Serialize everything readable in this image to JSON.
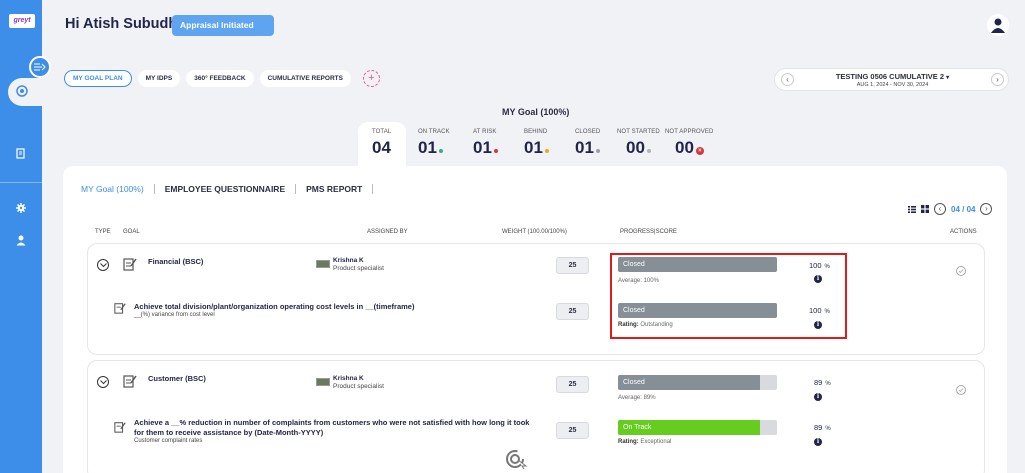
{
  "app": {
    "logo_text": "greyt"
  },
  "header": {
    "greeting": "Hi Atish Subudhi",
    "badge": "Appraisal Initiated"
  },
  "tabs": [
    "MY GOAL PLAN",
    "MY IDPS",
    "360° FEEDBACK",
    "CUMULATIVE REPORTS"
  ],
  "cycle": {
    "title": "TESTING 0506 CUMULATIVE 2",
    "dates": "AUG 1, 2024 - NOV 30, 2024"
  },
  "summary": {
    "title": "MY Goal (100%)",
    "stats": [
      {
        "label": "TOTAL",
        "value": "04"
      },
      {
        "label": "ON TRACK",
        "value": "01",
        "color": "#2bb673"
      },
      {
        "label": "AT RISK",
        "value": "01",
        "color": "#d9363e"
      },
      {
        "label": "BEHIND",
        "value": "01",
        "color": "#f2a91e"
      },
      {
        "label": "CLOSED",
        "value": "01",
        "color": "#9aa0a6"
      },
      {
        "label": "NOT STARTED",
        "value": "00",
        "color": "#b0b3b8"
      },
      {
        "label": "NOT APPROVED",
        "value": "00",
        "color": "#d9363e"
      }
    ]
  },
  "subtabs": [
    "MY Goal (100%)",
    "EMPLOYEE QUESTIONNAIRE",
    "PMS REPORT"
  ],
  "pagination": {
    "label": "04 / 04"
  },
  "columns": {
    "type": "TYPE",
    "goal": "GOAL",
    "assigned_by": "ASSIGNED BY",
    "weight": "WEIGHT (100.00/100%)",
    "progress": "PROGRESS|SCORE",
    "actions": "ACTIONS"
  },
  "goals": [
    {
      "name": "Financial (BSC)",
      "assigned_name": "Krishna K",
      "assigned_role": "Product specialist",
      "weight": "25",
      "status": "Closed",
      "progress": 1.0,
      "sub_label": "Average: 100%",
      "score": "100",
      "unit": "%",
      "sub": {
        "text": "Achieve total division/plant/organization operating cost levels in __(timeframe)",
        "subtext": "__(%) variance from cost level",
        "weight": "25",
        "status": "Closed",
        "progress": 1.0,
        "rating_label": "Rating:",
        "rating": "Outstanding",
        "score": "100",
        "unit": "%"
      }
    },
    {
      "name": "Customer (BSC)",
      "assigned_name": "Krishna K",
      "assigned_role": "Product specialist",
      "weight": "25",
      "status": "Closed",
      "progress": 0.89,
      "sub_label": "Average: 89%",
      "score": "89",
      "unit": "%",
      "sub": {
        "text_line1": "Achieve a __% reduction in number of complaints from customers who were not satisfied with how long it took",
        "text_line2": "for them to receive assistance by (Date-Month-YYYY)",
        "subtext": "Customer complaint rates",
        "weight": "25",
        "status": "On Track",
        "progress": 0.89,
        "rating_label": "Rating:",
        "rating": "Exceptional",
        "score": "89",
        "unit": "%"
      }
    }
  ],
  "colors": {
    "accent": "#3d8ee8",
    "closed_bar": "#868e96",
    "on_track_bar": "#66cc1f",
    "highlight": "#e01b1b"
  }
}
